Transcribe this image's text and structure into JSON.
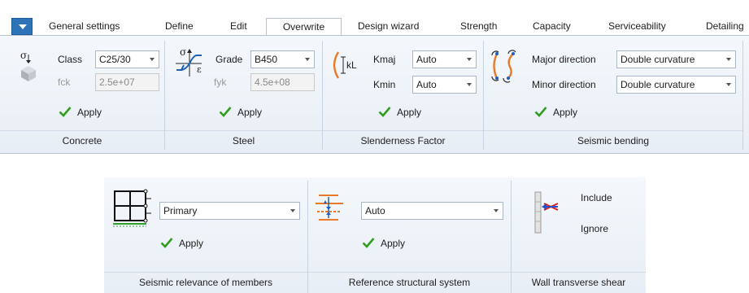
{
  "tabs": [
    {
      "label": "General settings"
    },
    {
      "label": "Define"
    },
    {
      "label": "Edit"
    },
    {
      "label": "Overwrite"
    },
    {
      "label": "Design wizard"
    },
    {
      "label": "Strength"
    },
    {
      "label": "Capacity"
    },
    {
      "label": "Serviceability"
    },
    {
      "label": "Detailing"
    }
  ],
  "concrete": {
    "symbol": "σ",
    "class_label": "Class",
    "class_value": "C25/30",
    "fck_label": "fck",
    "fck_value": "2.5e+07",
    "apply": "Apply",
    "group": "Concrete"
  },
  "steel": {
    "symbol_sigma": "σ",
    "symbol_eps": "ε",
    "grade_label": "Grade",
    "grade_value": "B450",
    "fyk_label": "fyk",
    "fyk_value": "4.5e+08",
    "apply": "Apply",
    "group": "Steel"
  },
  "slenderness": {
    "icon_text": "kL",
    "kmaj_label": "Kmaj",
    "kmaj_value": "Auto",
    "kmin_label": "Kmin",
    "kmin_value": "Auto",
    "apply": "Apply",
    "group": "Slenderness Factor"
  },
  "seismic_bending": {
    "major_label": "Major direction",
    "major_value": "Double curvature",
    "minor_label": "Minor direction",
    "minor_value": "Double curvature",
    "apply": "Apply",
    "group": "Seismic bending"
  },
  "seismic_relevance": {
    "value": "Primary",
    "apply": "Apply",
    "group": "Seismic relevance of members"
  },
  "reference_system": {
    "value": "Auto",
    "apply": "Apply",
    "group": "Reference structural system"
  },
  "wall_shear": {
    "include": "Include",
    "ignore": "Ignore",
    "group": "Wall transverse shear"
  },
  "colors": {
    "accent": "#2e73b8",
    "check": "#2f9e1f",
    "orange": "#e87a2a",
    "blue_arrow": "#2050d0",
    "red_arrow": "#e02020"
  }
}
